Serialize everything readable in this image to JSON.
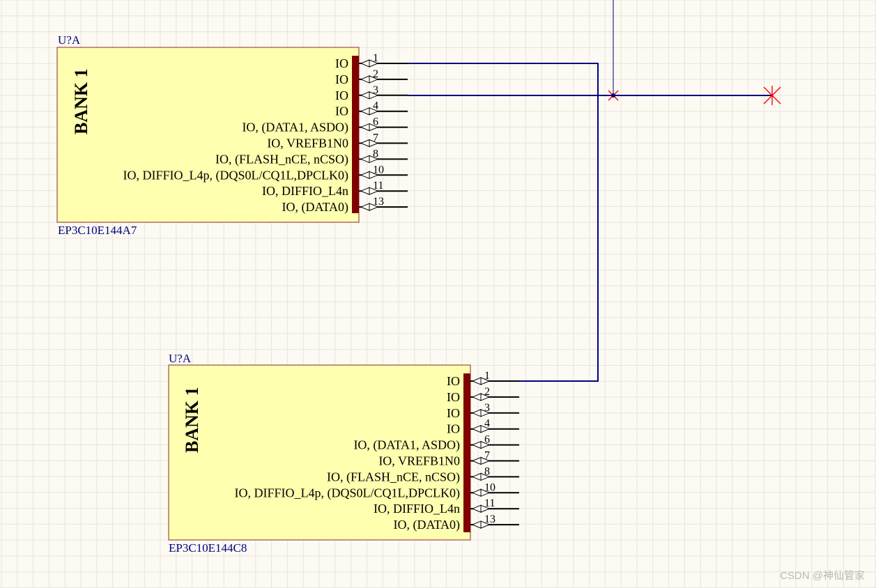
{
  "canvas": {
    "background": "#fcfaf3",
    "grid_color": "#e6e4dc",
    "body_fill": "#ffffb0",
    "body_stroke": "#8b2a2a",
    "pin_bar_color": "#800000",
    "wire_color": "#000080",
    "label_color": "#000080",
    "pin_color": "#000000",
    "error_color": "#ff0000"
  },
  "components": [
    {
      "designator": "U?A",
      "part_number": "EP3C10E144A7",
      "bank_label": "BANK 1",
      "pins": [
        {
          "number": "1",
          "name": "IO"
        },
        {
          "number": "2",
          "name": "IO"
        },
        {
          "number": "3",
          "name": "IO"
        },
        {
          "number": "4",
          "name": "IO"
        },
        {
          "number": "6",
          "name": "IO, (DATA1, ASDO)"
        },
        {
          "number": "7",
          "name": "IO, VREFB1N0"
        },
        {
          "number": "8",
          "name": "IO, (FLASH_nCE, nCSO)"
        },
        {
          "number": "10",
          "name": "IO, DIFFIO_L4p, (DQS0L/CQ1L,DPCLK0)"
        },
        {
          "number": "11",
          "name": "IO, DIFFIO_L4n"
        },
        {
          "number": "13",
          "name": "IO, (DATA0)"
        }
      ]
    },
    {
      "designator": "U?A",
      "part_number": "EP3C10E144C8",
      "bank_label": "BANK 1",
      "pins": [
        {
          "number": "1",
          "name": "IO"
        },
        {
          "number": "2",
          "name": "IO"
        },
        {
          "number": "3",
          "name": "IO"
        },
        {
          "number": "4",
          "name": "IO"
        },
        {
          "number": "6",
          "name": "IO, (DATA1, ASDO)"
        },
        {
          "number": "7",
          "name": "IO, VREFB1N0"
        },
        {
          "number": "8",
          "name": "IO, (FLASH_nCE, nCSO)"
        },
        {
          "number": "10",
          "name": "IO, DIFFIO_L4p, (DQS0L/CQ1L,DPCLK0)"
        },
        {
          "number": "11",
          "name": "IO, DIFFIO_L4n"
        },
        {
          "number": "13",
          "name": "IO, (DATA0)"
        }
      ]
    }
  ],
  "watermark": "CSDN @神仙管家"
}
